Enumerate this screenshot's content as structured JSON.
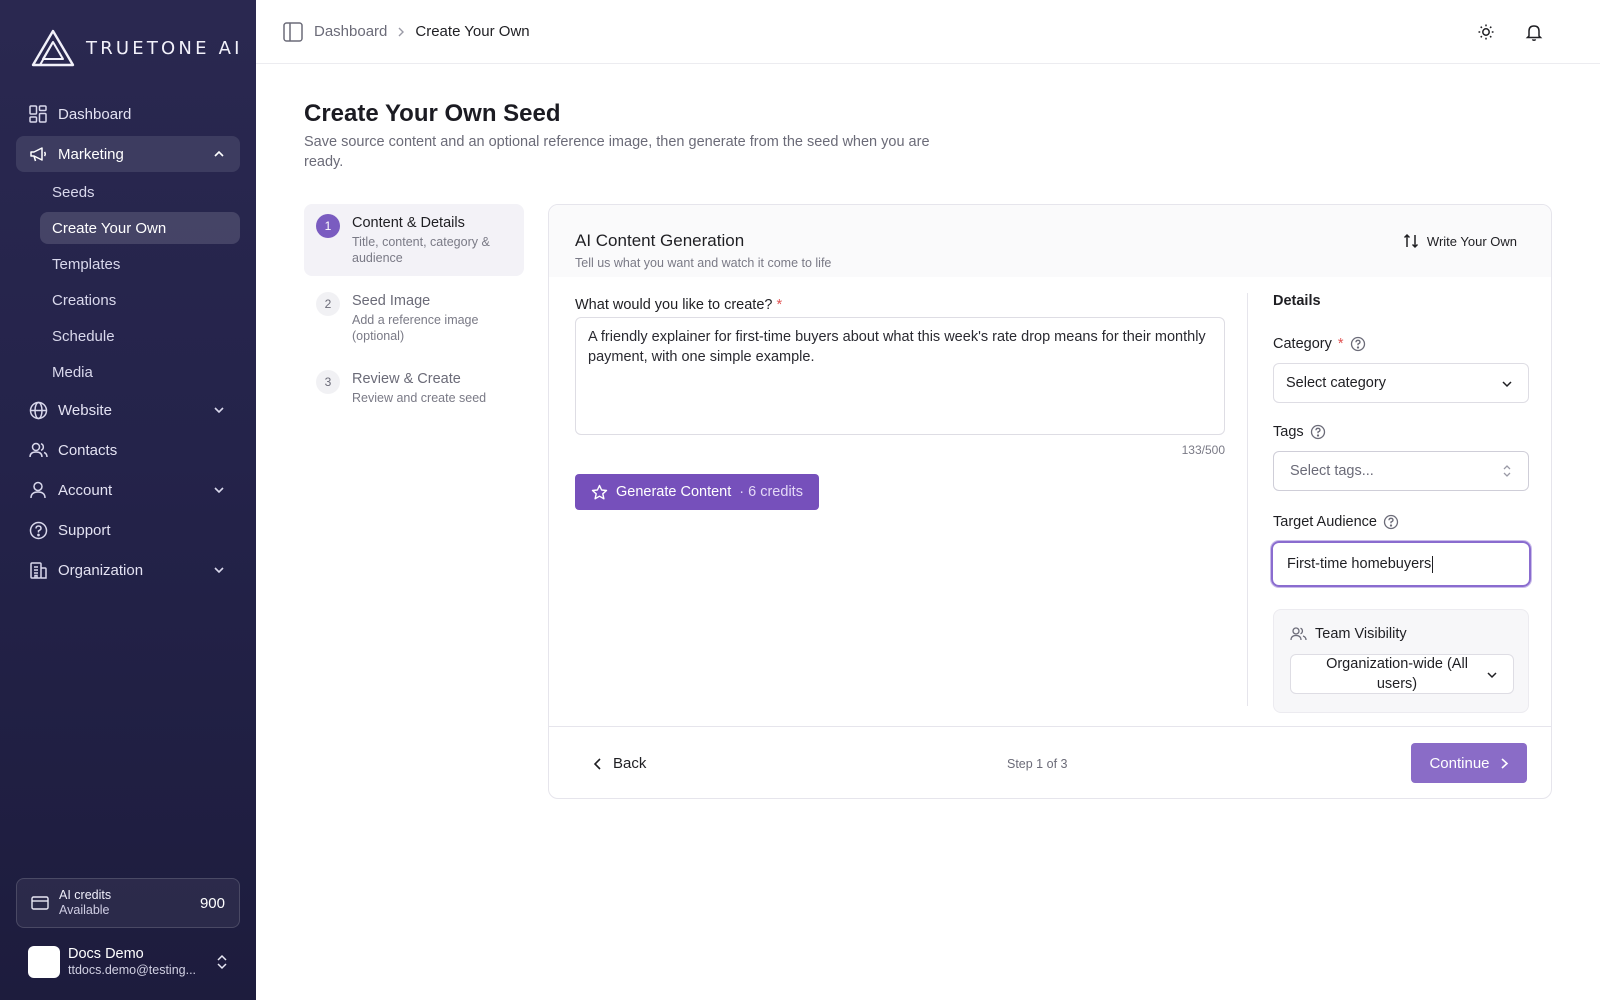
{
  "app": {
    "brand": "TRUETONE AI"
  },
  "sidebar": {
    "items": [
      {
        "label": "Dashboard",
        "icon": "grid-icon"
      },
      {
        "label": "Marketing",
        "icon": "megaphone-icon"
      },
      {
        "label": "Website",
        "icon": "globe-icon"
      },
      {
        "label": "Contacts",
        "icon": "users-icon"
      },
      {
        "label": "Account",
        "icon": "user-icon"
      },
      {
        "label": "Support",
        "icon": "help-icon"
      },
      {
        "label": "Organization",
        "icon": "building-icon"
      }
    ],
    "marketing_sub": [
      "Seeds",
      "Create Your Own",
      "Templates",
      "Creations",
      "Schedule",
      "Media"
    ],
    "credits": {
      "label": "AI credits",
      "sub": "Available",
      "value": "900"
    },
    "user": {
      "name": "Docs Demo",
      "email": "ttdocs.demo@testing..."
    }
  },
  "topbar": {
    "breadcrumb": [
      "Dashboard",
      "Create Your Own"
    ]
  },
  "page": {
    "title": "Create Your Own Seed",
    "subtitle": "Save source content and an optional reference image, then generate from the seed when you are ready."
  },
  "steps": [
    {
      "num": "1",
      "title": "Content & Details",
      "desc": "Title, content, category & audience"
    },
    {
      "num": "2",
      "title": "Seed Image",
      "desc": "Add a reference image (optional)"
    },
    {
      "num": "3",
      "title": "Review & Create",
      "desc": "Review and create seed"
    }
  ],
  "card": {
    "title": "AI Content Generation",
    "subtitle": "Tell us what you want and watch it come to life",
    "write_own": "Write Your Own",
    "question_label": "What would you like to create?",
    "required_mark": "*",
    "prompt_value": "A friendly explainer for first-time buyers about what this week's rate drop means for their monthly payment, with one simple example.",
    "counter": "133/500",
    "generate_label": "Generate Content",
    "generate_credits": "· 6 credits",
    "details": {
      "heading": "Details",
      "category_label": "Category",
      "category_value": "Select category",
      "tags_label": "Tags",
      "tags_placeholder": "Select tags...",
      "audience_label": "Target Audience",
      "audience_value": "First-time homebuyers",
      "team_label": "Team Visibility",
      "team_value": "Organization-wide (All users)"
    },
    "footer": {
      "back": "Back",
      "step_of": "Step 1 of 3",
      "continue": "Continue"
    }
  },
  "colors": {
    "accent": "#7650bb",
    "sidebar_bg": "#24234a"
  }
}
